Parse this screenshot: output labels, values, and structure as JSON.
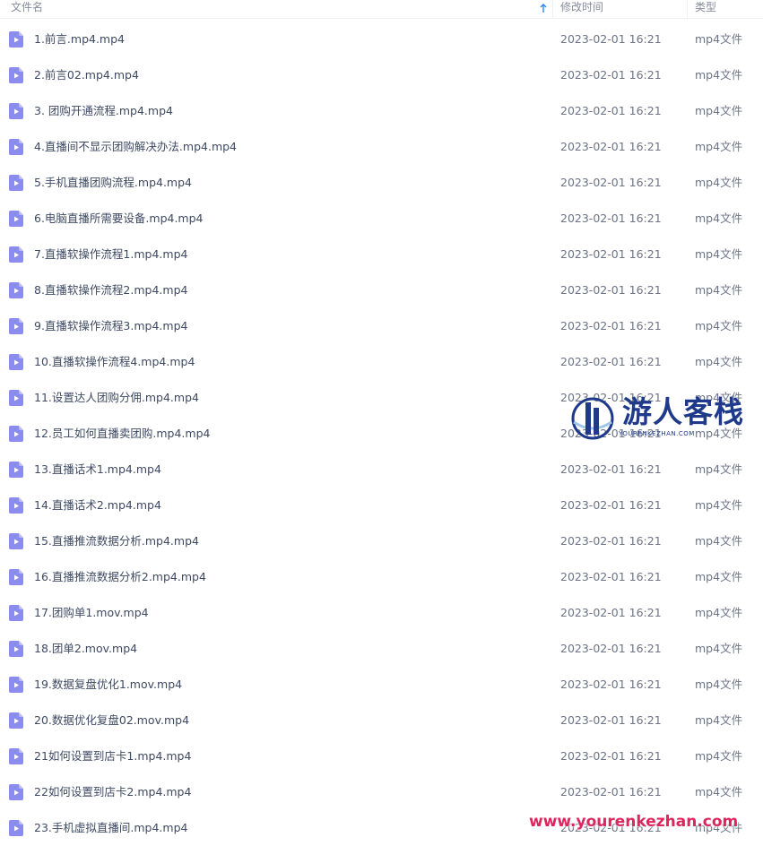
{
  "header": {
    "name_label": "文件名",
    "date_label": "修改时间",
    "type_label": "类型",
    "sort_icon": "sort-ascending-arrow-icon"
  },
  "colors": {
    "file_icon": "#8b8cf0",
    "header_text": "#878c9c",
    "sort_arrow": "#2e86f5",
    "watermark_logo": "#1f3a8a",
    "watermark_url": "#e0245e"
  },
  "files": [
    {
      "name": "1.前言.mp4.mp4",
      "date": "2023-02-01 16:21",
      "type": "mp4文件"
    },
    {
      "name": "2.前言02.mp4.mp4",
      "date": "2023-02-01 16:21",
      "type": "mp4文件"
    },
    {
      "name": "3. 团购开通流程.mp4.mp4",
      "date": "2023-02-01 16:21",
      "type": "mp4文件"
    },
    {
      "name": "4.直播间不显示团购解决办法.mp4.mp4",
      "date": "2023-02-01 16:21",
      "type": "mp4文件"
    },
    {
      "name": "5.手机直播团购流程.mp4.mp4",
      "date": "2023-02-01 16:21",
      "type": "mp4文件"
    },
    {
      "name": "6.电脑直播所需要设备.mp4.mp4",
      "date": "2023-02-01 16:21",
      "type": "mp4文件"
    },
    {
      "name": "7.直播软操作流程1.mp4.mp4",
      "date": "2023-02-01 16:21",
      "type": "mp4文件"
    },
    {
      "name": "8.直播软操作流程2.mp4.mp4",
      "date": "2023-02-01 16:21",
      "type": "mp4文件"
    },
    {
      "name": "9.直播软操作流程3.mp4.mp4",
      "date": "2023-02-01 16:21",
      "type": "mp4文件"
    },
    {
      "name": "10.直播软操作流程4.mp4.mp4",
      "date": "2023-02-01 16:21",
      "type": "mp4文件"
    },
    {
      "name": "11.设置达人团购分佣.mp4.mp4",
      "date": "2023-02-01 16:21",
      "type": "mp4文件"
    },
    {
      "name": "12.员工如何直播卖团购.mp4.mp4",
      "date": "2023-02-01 16:21",
      "type": "mp4文件"
    },
    {
      "name": "13.直播话术1.mp4.mp4",
      "date": "2023-02-01 16:21",
      "type": "mp4文件"
    },
    {
      "name": "14.直播话术2.mp4.mp4",
      "date": "2023-02-01 16:21",
      "type": "mp4文件"
    },
    {
      "name": "15.直播推流数据分析.mp4.mp4",
      "date": "2023-02-01 16:21",
      "type": "mp4文件"
    },
    {
      "name": "16.直播推流数据分析2.mp4.mp4",
      "date": "2023-02-01 16:21",
      "type": "mp4文件"
    },
    {
      "name": "17.团购单1.mov.mp4",
      "date": "2023-02-01 16:21",
      "type": "mp4文件"
    },
    {
      "name": "18.团单2.mov.mp4",
      "date": "2023-02-01 16:21",
      "type": "mp4文件"
    },
    {
      "name": "19.数据复盘优化1.mov.mp4",
      "date": "2023-02-01 16:21",
      "type": "mp4文件"
    },
    {
      "name": "20.数据优化复盘02.mov.mp4",
      "date": "2023-02-01 16:21",
      "type": "mp4文件"
    },
    {
      "name": "21如何设置到店卡1.mp4.mp4",
      "date": "2023-02-01 16:21",
      "type": "mp4文件"
    },
    {
      "name": "22如何设置到店卡2.mp4.mp4",
      "date": "2023-02-01 16:21",
      "type": "mp4文件"
    },
    {
      "name": "23.手机虚拟直播间.mp4.mp4",
      "date": "2023-02-01 16:21",
      "type": "mp4文件"
    }
  ],
  "watermark": {
    "logo_text": "游人客栈",
    "logo_subtext": "YOURENKEZHAN.COM",
    "url_text": "www.yourenkezhan.com"
  }
}
